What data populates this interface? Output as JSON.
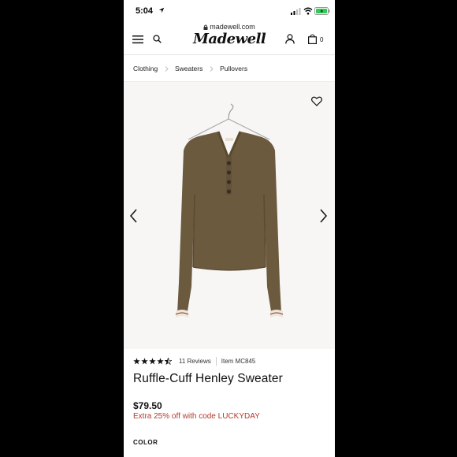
{
  "status_bar": {
    "time": "5:04"
  },
  "browser": {
    "url": "madewell.com"
  },
  "header": {
    "logo": "Madewell",
    "bag_count": "0"
  },
  "breadcrumb": [
    {
      "label": "Clothing"
    },
    {
      "label": "Sweaters"
    },
    {
      "label": "Pullovers"
    }
  ],
  "product": {
    "rating_stars": 4.5,
    "reviews": "11 Reviews",
    "item_number": "Item MC845",
    "title": "Ruffle-Cuff Henley Sweater",
    "price": "$79.50",
    "promo": "Extra 25% off with code LUCKYDAY",
    "color_heading": "COLOR"
  },
  "colors": {
    "sweater": "#6b5a3e",
    "promo_text": "#b23a2f",
    "gallery_bg": "#f7f6f4"
  }
}
